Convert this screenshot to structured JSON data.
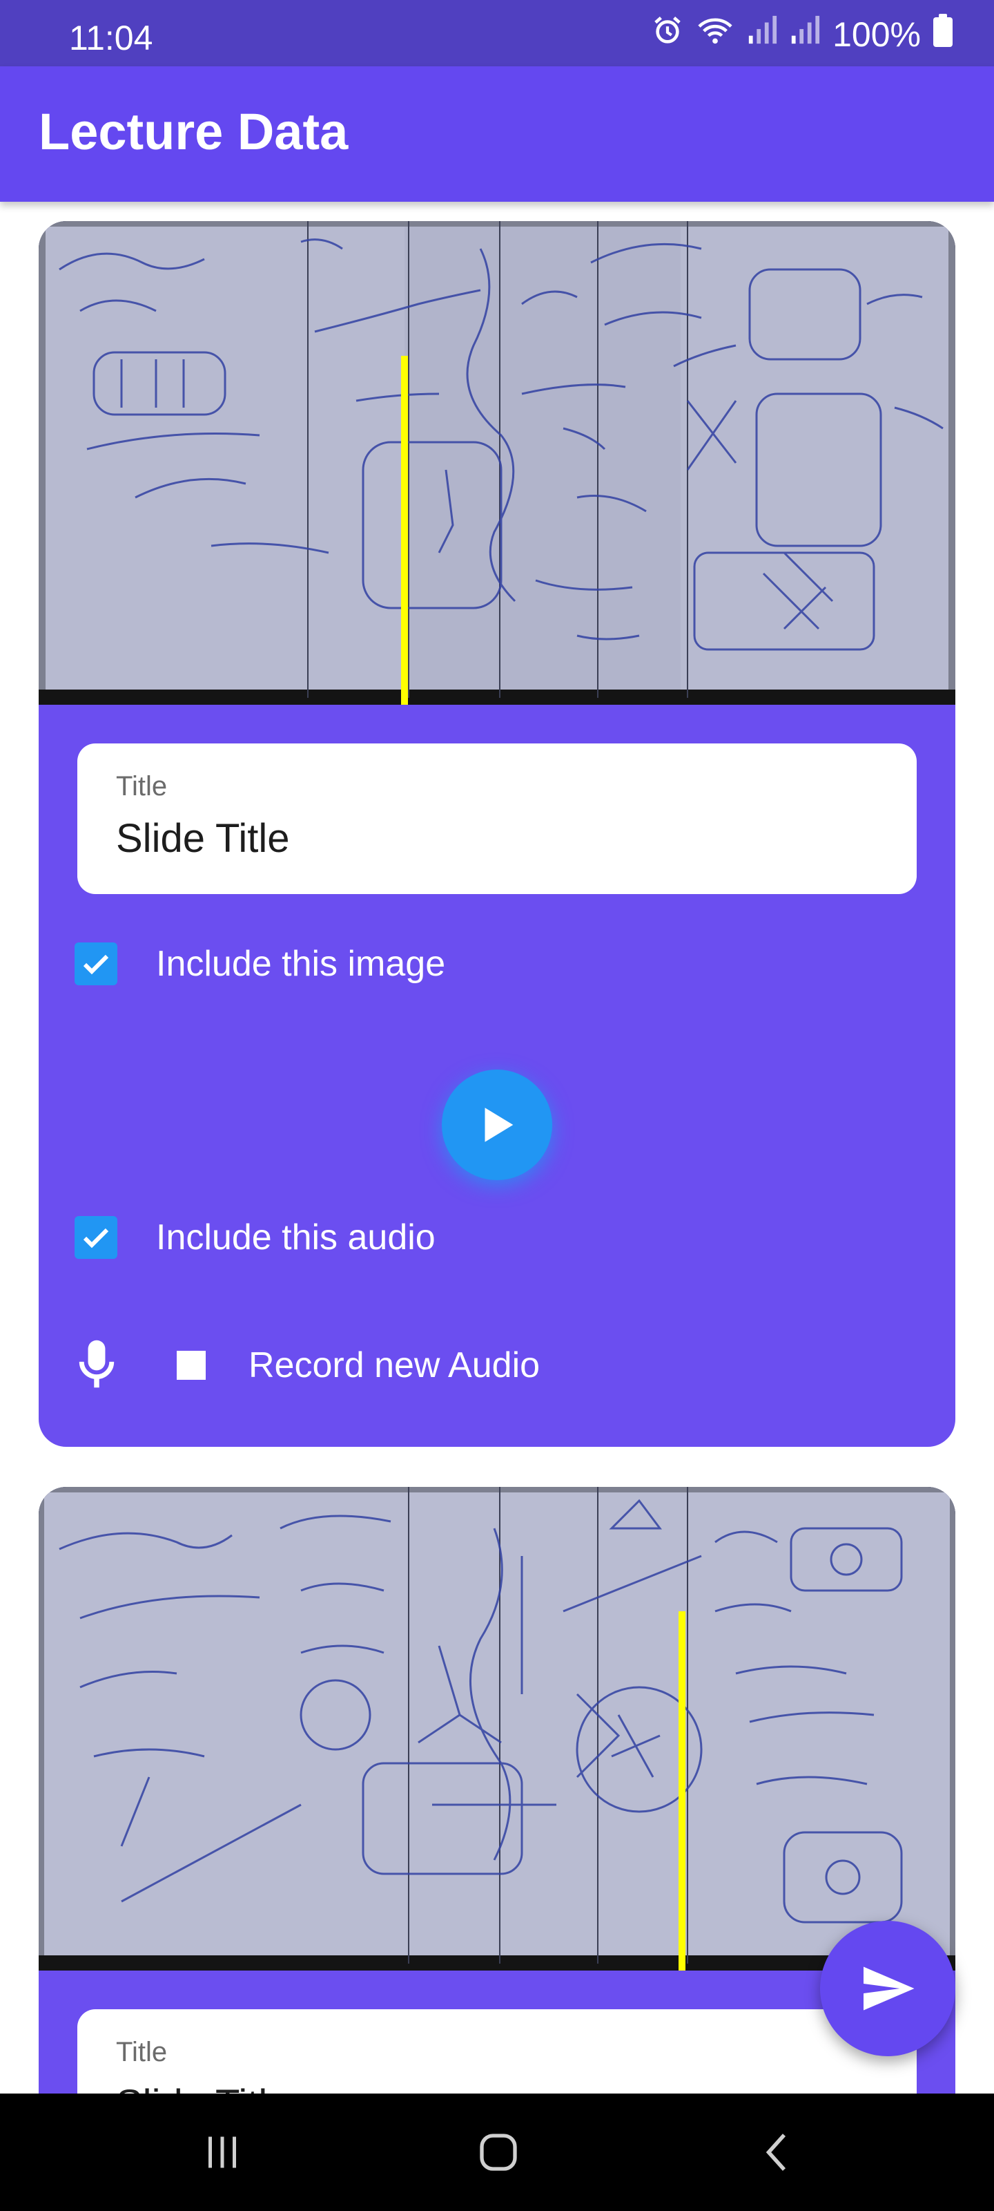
{
  "status_bar": {
    "time": "11:04",
    "battery": "100%",
    "icons": [
      "alarm-icon",
      "wifi-icon",
      "signal-icon",
      "signal-icon",
      "battery-icon"
    ]
  },
  "app_bar": {
    "title": "Lecture Data"
  },
  "slides": [
    {
      "title_label": "Title",
      "title_value": "Slide Title",
      "include_image_label": "Include this image",
      "include_image_checked": true,
      "include_audio_label": "Include this audio",
      "include_audio_checked": true,
      "record_label": "Record new Audio"
    },
    {
      "title_label": "Title",
      "title_value": "Slide Title"
    }
  ],
  "fab": {
    "icon": "send-icon"
  },
  "nav_bar": {
    "icons": [
      "recents-icon",
      "home-icon",
      "back-icon"
    ]
  },
  "colors": {
    "primary": "#6448F0",
    "status_bar": "#5040C0",
    "card": "#6B4EF0",
    "accent": "#2196F3",
    "marker_line": "#FFFF00"
  }
}
